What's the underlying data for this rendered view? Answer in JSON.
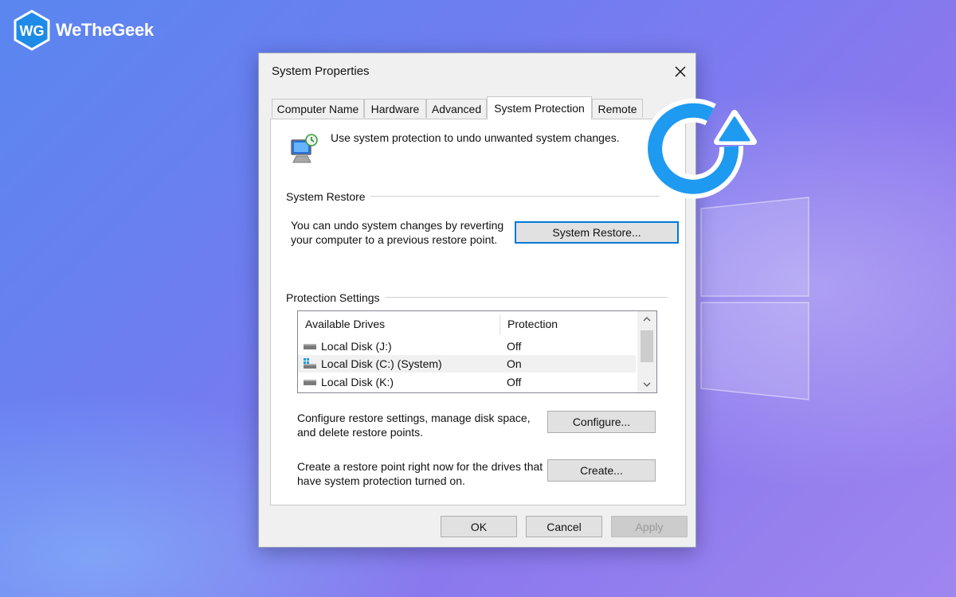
{
  "brand": {
    "name": "WeTheGeek",
    "logo_letters": "WG"
  },
  "colors": {
    "accent": "#0078d7",
    "refresh_icon": "#1e9af0",
    "brand_badge": "#1f8be8"
  },
  "dialog": {
    "title": "System Properties",
    "close_icon": "close-icon",
    "tabs": [
      {
        "label": "Computer Name",
        "active": false
      },
      {
        "label": "Hardware",
        "active": false
      },
      {
        "label": "Advanced",
        "active": false
      },
      {
        "label": "System Protection",
        "active": true
      },
      {
        "label": "Remote",
        "active": false
      }
    ],
    "intro_text": "Use system protection to undo unwanted system changes.",
    "system_restore": {
      "group_label": "System Restore",
      "description_line1": "You can undo system changes by reverting",
      "description_line2": "your computer to a previous restore point.",
      "button_label": "System Restore..."
    },
    "protection_settings": {
      "group_label": "Protection Settings",
      "columns": {
        "drive": "Available Drives",
        "protection": "Protection"
      },
      "drives": [
        {
          "name": "Local Disk (J:)",
          "protection": "Off",
          "system": false
        },
        {
          "name": "Local Disk (C:) (System)",
          "protection": "On",
          "system": true
        },
        {
          "name": "Local Disk (K:)",
          "protection": "Off",
          "system": false
        }
      ],
      "configure_text_line1": "Configure restore settings, manage disk space,",
      "configure_text_line2": "and delete restore points.",
      "configure_button": "Configure...",
      "create_text_line1": "Create a restore point right now for the drives that",
      "create_text_line2": "have system protection turned on.",
      "create_button": "Create..."
    },
    "footer": {
      "ok": "OK",
      "cancel": "Cancel",
      "apply": "Apply"
    }
  }
}
